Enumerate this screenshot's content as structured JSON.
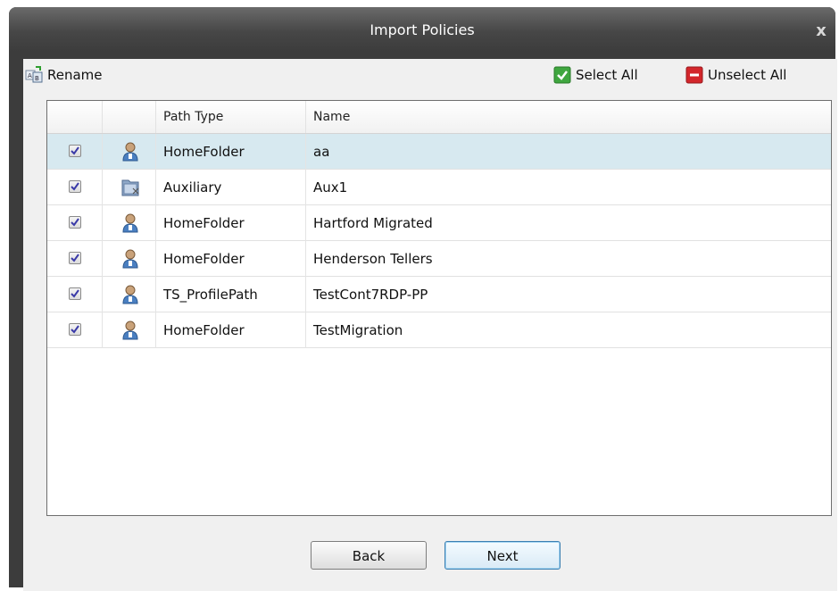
{
  "window": {
    "title": "Import Policies",
    "close_glyph": "x"
  },
  "toolbar": {
    "rename_label": "Rename",
    "rename_icon": "rename-icon",
    "select_all_label": "Select All",
    "select_all_icon": "green-check-icon",
    "unselect_all_label": "Unselect All",
    "unselect_all_icon": "red-minus-icon"
  },
  "grid": {
    "columns": [
      "",
      "",
      "Path Type",
      "Name"
    ],
    "rows": [
      {
        "checked": true,
        "icon": "user-icon",
        "path_type": "HomeFolder",
        "name": "aa",
        "selected": true
      },
      {
        "checked": true,
        "icon": "auxiliary-folder-icon",
        "path_type": "Auxiliary",
        "name": "Aux1",
        "selected": false
      },
      {
        "checked": true,
        "icon": "user-icon",
        "path_type": "HomeFolder",
        "name": "Hartford Migrated",
        "selected": false
      },
      {
        "checked": true,
        "icon": "user-icon",
        "path_type": "HomeFolder",
        "name": "Henderson Tellers",
        "selected": false
      },
      {
        "checked": true,
        "icon": "user-icon",
        "path_type": "TS_ProfilePath",
        "name": "TestCont7RDP-PP",
        "selected": false
      },
      {
        "checked": true,
        "icon": "user-icon",
        "path_type": "HomeFolder",
        "name": "TestMigration",
        "selected": false
      }
    ]
  },
  "buttons": {
    "back_label": "Back",
    "next_label": "Next"
  },
  "colors": {
    "selected_row": "#d7e9f0",
    "title_bar": "#474747"
  }
}
